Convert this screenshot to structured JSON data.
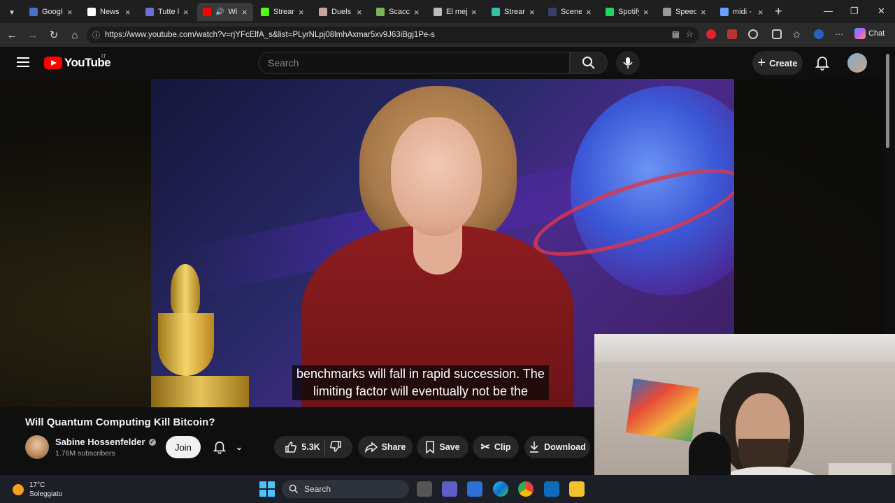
{
  "browser": {
    "tabs": [
      {
        "title": "Google",
        "icon": "google-icon",
        "color": "#4a6fd1"
      },
      {
        "title": "News /",
        "icon": "x-icon",
        "color": "#ffffff"
      },
      {
        "title": "Tutte le",
        "icon": "forum-icon",
        "color": "#6b6fd6"
      },
      {
        "title": "Wil",
        "icon": "youtube-icon",
        "color": "#ff0000",
        "active": true
      },
      {
        "title": "Stream",
        "icon": "kick-icon",
        "color": "#53fc18"
      },
      {
        "title": "Duels -",
        "icon": "map-pin-icon",
        "color": "#c9a2a2"
      },
      {
        "title": "Scacchi",
        "icon": "chess-pawn-icon",
        "color": "#7bb55a"
      },
      {
        "title": "El mejo",
        "icon": "globe-icon",
        "color": "#bbbbbb"
      },
      {
        "title": "Streaml",
        "icon": "streamlabs-icon",
        "color": "#31c3a2"
      },
      {
        "title": "Scene E",
        "icon": "obs-icon",
        "color": "#3a3f6a"
      },
      {
        "title": "Spotify",
        "icon": "spotify-icon",
        "color": "#1ed760"
      },
      {
        "title": "Speedt",
        "icon": "speedtest-icon",
        "color": "#9a9a9a"
      },
      {
        "title": "midi -",
        "icon": "search-icon",
        "color": "#6aa0ff"
      }
    ],
    "url": "https://www.youtube.com/watch?v=rjYFcElfA_s&list=PLyrNLpj08lmhAxmar5xv9J63iBgj1Pe-s",
    "chat_label": "Chat"
  },
  "youtube": {
    "logo_text": "YouTube",
    "region": "IT",
    "search_placeholder": "Search",
    "create_label": "Create"
  },
  "video": {
    "caption_line1": "benchmarks will fall in rapid succession. The",
    "caption_line2": "limiting factor will eventually not be the",
    "title": "Will Quantum Computing Kill Bitcoin?",
    "channel": "Sabine Hossenfelder",
    "subscribers": "1.76M subscribers",
    "join_label": "Join",
    "likes": "5.3K",
    "share_label": "Share",
    "save_label": "Save",
    "clip_label": "Clip",
    "download_label": "Download"
  },
  "taskbar": {
    "temperature": "17°C",
    "weather": "Soleggiato",
    "search_label": "Search"
  },
  "colors": {
    "youtube_red": "#ff0000",
    "background": "#0f0f0f",
    "pill": "#272727"
  }
}
